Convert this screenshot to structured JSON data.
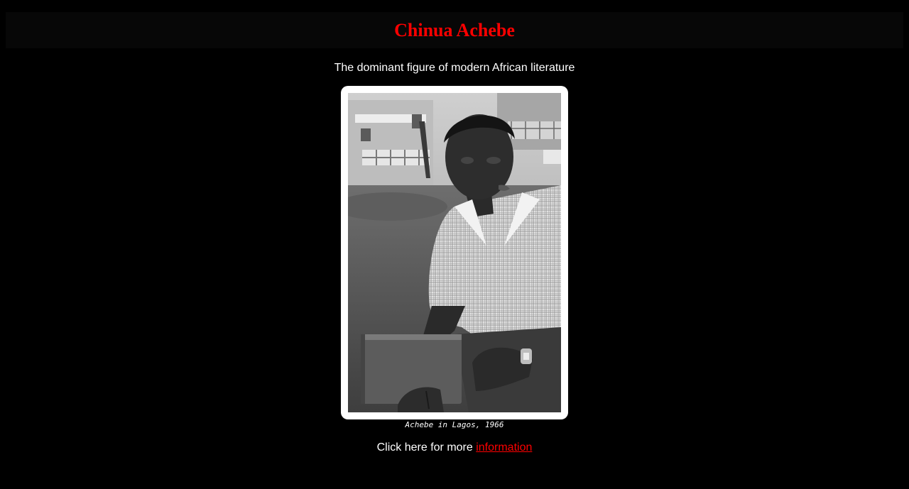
{
  "header": {
    "title": "Chinua Achebe"
  },
  "subtitle": "The dominant figure of modern African literature",
  "photo": {
    "alt": "Achebe in Lagos, 1966",
    "caption": "Achebe in Lagos, 1966"
  },
  "more_info": {
    "prefix": "Click here for more ",
    "link_text": "information"
  },
  "colors": {
    "background": "#000000",
    "title": "#ff0000",
    "link": "#ff0000",
    "text": "#ffffff",
    "frame": "#ffffff"
  }
}
